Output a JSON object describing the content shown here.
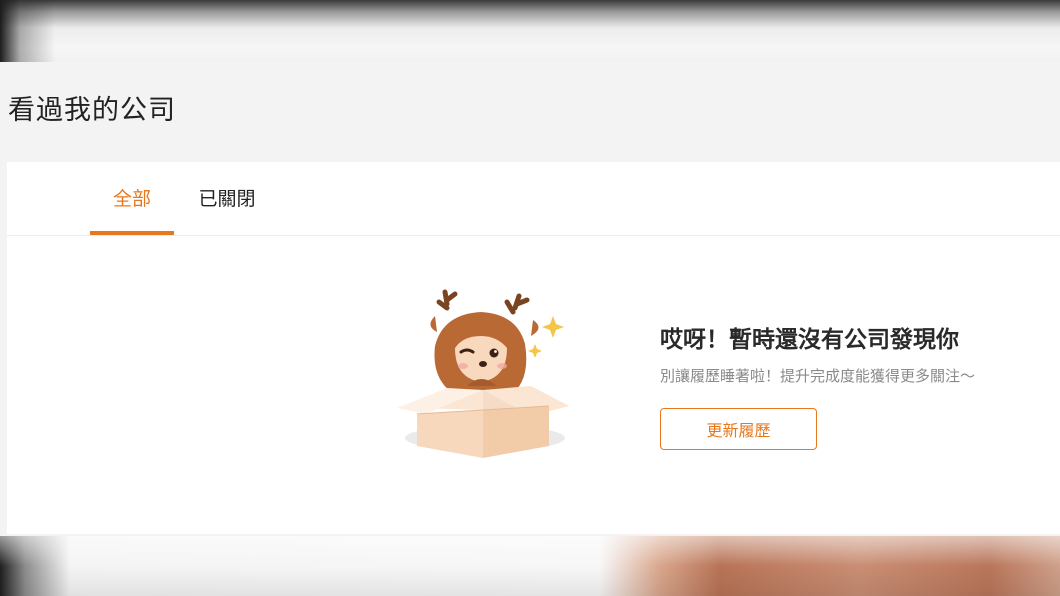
{
  "page": {
    "title": "看過我的公司"
  },
  "tabs": [
    {
      "label": "全部",
      "active": true
    },
    {
      "label": "已關閉",
      "active": false
    }
  ],
  "empty_state": {
    "title": "哎呀！暫時還沒有公司發現你",
    "subtitle": "別讓履歷睡著啦！提升完成度能獲得更多關注～",
    "button_label": "更新履歷",
    "illustration": "deer-in-box"
  },
  "colors": {
    "accent": "#e8781e",
    "background": "#f3f3f3",
    "card": "#ffffff",
    "title_text": "#222222",
    "subtitle_text": "#8a8a8a"
  }
}
